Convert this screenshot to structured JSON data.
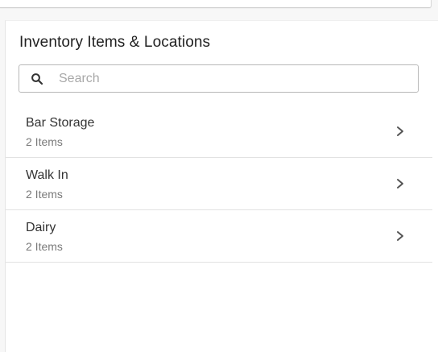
{
  "panel": {
    "title": "Inventory Items & Locations"
  },
  "search": {
    "placeholder": "Search",
    "value": "",
    "icon": "search-icon"
  },
  "locations": [
    {
      "name": "Bar Storage",
      "count": "2 Items",
      "icon": "chevron-right-icon"
    },
    {
      "name": "Walk In",
      "count": "2 Items",
      "icon": "chevron-right-icon"
    },
    {
      "name": "Dairy",
      "count": "2 Items",
      "icon": "chevron-right-icon"
    }
  ],
  "colors": {
    "text_primary": "#212121",
    "text_secondary": "#7a7a7a",
    "divider": "#e2e2e2",
    "search_border": "#b8b8b8"
  }
}
